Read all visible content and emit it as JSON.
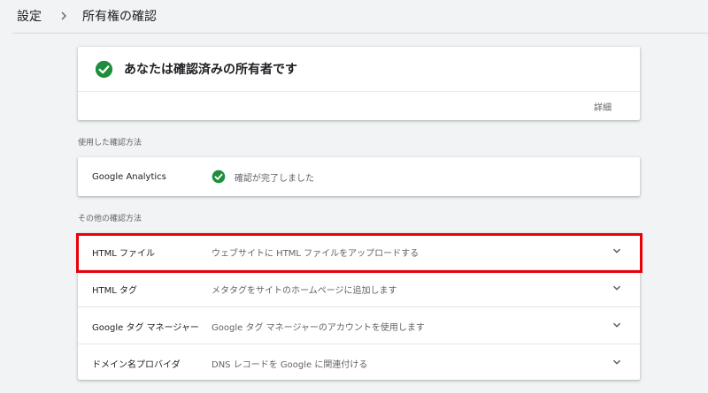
{
  "breadcrumb": {
    "parent": "設定",
    "current": "所有権の確認"
  },
  "owner_card": {
    "title": "あなたは確認済みの所有者です",
    "detail_link": "詳細",
    "icon": "check-circle-icon"
  },
  "used_section": {
    "label": "使用した確認方法",
    "method_name": "Google Analytics",
    "status": "確認が完了しました",
    "icon": "check-circle-icon"
  },
  "other_section": {
    "label": "その他の確認方法",
    "methods": [
      {
        "name": "HTML ファイル",
        "description": "ウェブサイトに HTML ファイルをアップロードする"
      },
      {
        "name": "HTML タグ",
        "description": "メタタグをサイトのホームページに追加します"
      },
      {
        "name": "Google タグ マネージャー",
        "description": "Google タグ マネージャーのアカウントを使用します"
      },
      {
        "name": "ドメイン名プロバイダ",
        "description": "DNS レコードを Google に関連付ける"
      }
    ]
  },
  "colors": {
    "success": "#1e8e3e",
    "highlight": "#e8000b",
    "background": "#f1f3f4"
  }
}
